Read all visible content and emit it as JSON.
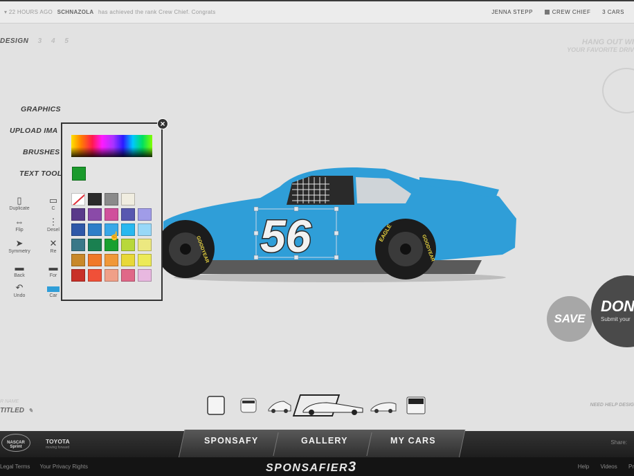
{
  "topbar": {
    "ticker_prefix": "▾",
    "ticker_time": "22 HOURS AGO",
    "ticker_user": "SCHNAZOLA",
    "ticker_text": "has achieved the rank Crew Chief. Congrats",
    "user_name": "JENNA STEPP",
    "rank": "CREW CHIEF",
    "cars": "3 CARS"
  },
  "steps": {
    "current": "DESIGN",
    "others": [
      "3",
      "4",
      "5"
    ]
  },
  "promo": {
    "line1": "HANG OUT WI",
    "line2": "YOUR FAVORITE DRIV"
  },
  "menu": {
    "graphics": "GRAPHICS",
    "upload": "UPLOAD IMA",
    "brushes": "BRUSHES",
    "text_tool": "TEXT TOOL"
  },
  "tools": {
    "duplicate": "Duplicate",
    "copy": "C",
    "flip": "Flip",
    "deselect": "Desel",
    "symmetry": "Symmetry",
    "reset": "Re",
    "back": "Back",
    "forward": "For",
    "undo": "Undo",
    "car": "Car"
  },
  "picker": {
    "current_color": "#1a9a2c",
    "swatches": [
      "none",
      "#2b2b2b",
      "#8a8a8a",
      "#f0ede0",
      "",
      "#5a3a8a",
      "#8a4aa8",
      "#d0509c",
      "#5858b0",
      "#a09ce8",
      "#2e58a8",
      "#2e7ec8",
      "#38a8e8",
      "#28b8f0",
      "#98d8f8",
      "#3a7888",
      "#1a8050",
      "#1aa030",
      "#b8d83a",
      "#ece880",
      "#c8882a",
      "#f07828",
      "#f09838",
      "#e8d838",
      "#ecea58",
      "#c83028",
      "#f05038",
      "#f0a088",
      "#e06888",
      "#e8b8e0"
    ]
  },
  "car": {
    "number": "56",
    "body_color": "#2f9ed8",
    "tire_brand": "GOODYEAR",
    "tire_model": "EAGLE"
  },
  "actions": {
    "save": "SAVE",
    "done": "DON",
    "done_sub": "Submit your"
  },
  "project": {
    "label": "R NAME",
    "name": "TITLED",
    "help": "NEED HELP DESIG"
  },
  "nav": {
    "tabs": [
      "SPONSAFY",
      "GALLERY",
      "MY CARS"
    ],
    "share": "Share:"
  },
  "sponsors": {
    "sprint": "NASCAR Sprint",
    "toyota": "TOYOTA",
    "toyota_tag": "moving forward"
  },
  "footer": {
    "links": [
      "Legal Terms",
      "Your Privacy Rights"
    ],
    "brand": "SPONSAFIER",
    "brand_num": "3",
    "right_links": [
      "Help",
      "Videos",
      "Pr"
    ]
  }
}
